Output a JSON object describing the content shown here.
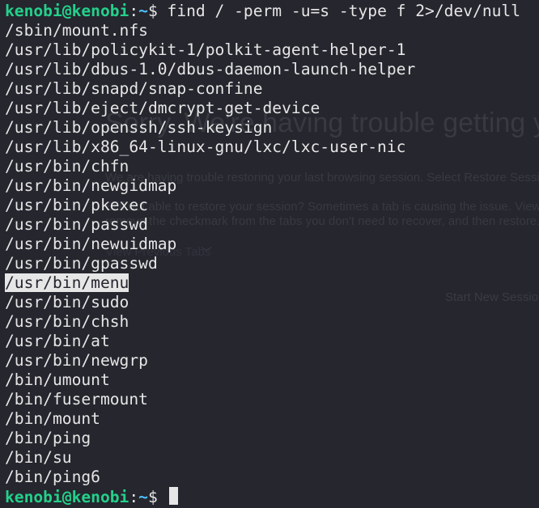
{
  "ghost": {
    "title": "Sorry. We're having trouble getting your",
    "p1": "We are having trouble restoring your last browsing session. Select Restore Session to t",
    "p2a": "Still not able to restore your session? Sometimes a tab is causing the issue. View previou",
    "p2b": "remove the checkmark from the tabs you don't need to recover, and then restore.",
    "link": "View Previous Tabs",
    "chev": "﹀",
    "button": "Start New Sessio"
  },
  "prompt1": {
    "user": "kenobi",
    "at": "@",
    "host": "kenobi",
    "colon": ":",
    "path": "~",
    "dollar": "$ ",
    "command": "find / -perm -u=s -type f 2>/dev/null "
  },
  "output": [
    "/sbin/mount.nfs",
    "/usr/lib/policykit-1/polkit-agent-helper-1",
    "/usr/lib/dbus-1.0/dbus-daemon-launch-helper",
    "/usr/lib/snapd/snap-confine",
    "/usr/lib/eject/dmcrypt-get-device",
    "/usr/lib/openssh/ssh-keysign",
    "/usr/lib/x86_64-linux-gnu/lxc/lxc-user-nic",
    "/usr/bin/chfn",
    "/usr/bin/newgidmap",
    "/usr/bin/pkexec",
    "/usr/bin/passwd",
    "/usr/bin/newuidmap",
    "/usr/bin/gpasswd"
  ],
  "highlighted": "/usr/bin/menu",
  "output2": [
    "/usr/bin/sudo",
    "/usr/bin/chsh",
    "/usr/bin/at",
    "/usr/bin/newgrp",
    "/bin/umount",
    "/bin/fusermount",
    "/bin/mount",
    "/bin/ping",
    "/bin/su",
    "/bin/ping6"
  ],
  "prompt2": {
    "user": "kenobi",
    "at": "@",
    "host": "kenobi",
    "colon": ":",
    "path": "~",
    "dollar": "$ "
  }
}
